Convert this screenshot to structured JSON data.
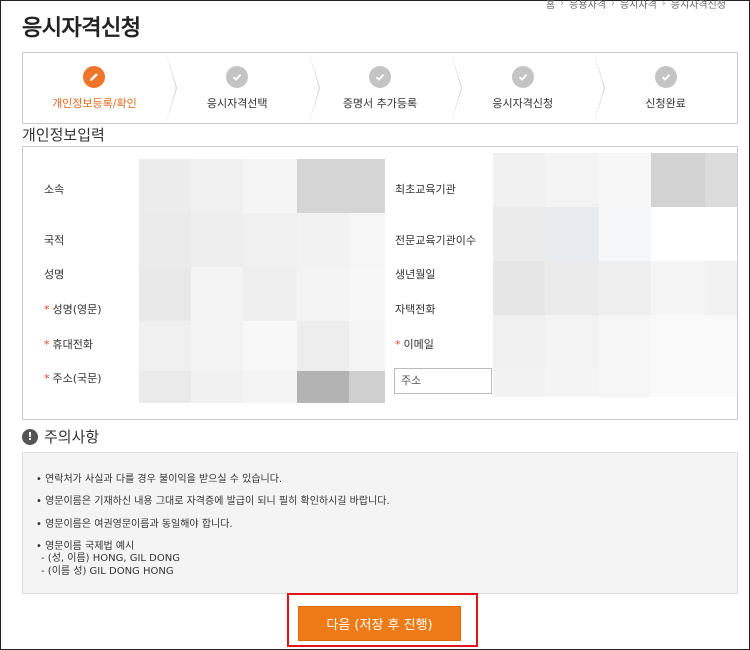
{
  "breadcrumb": [
    "홈",
    "응용자격",
    "응시자격",
    "응시자격신청"
  ],
  "page_title": "응시자격신청",
  "steps": [
    {
      "label": "개인정보등록/확인",
      "active": true,
      "icon": "pencil-icon"
    },
    {
      "label": "응시자격선택",
      "active": false,
      "icon": "check-icon"
    },
    {
      "label": "증명서 추가등록",
      "active": false,
      "icon": "check-icon"
    },
    {
      "label": "응시자격신청",
      "active": false,
      "icon": "check-icon"
    },
    {
      "label": "신청완료",
      "active": false,
      "icon": "check-icon"
    }
  ],
  "section_title": "개인정보입력",
  "fields_left": [
    {
      "label": "소속",
      "required": false
    },
    {
      "label": "국적",
      "required": false
    },
    {
      "label": "성명",
      "required": false
    },
    {
      "label": "성명(영문)",
      "required": true
    },
    {
      "label": "휴대전화",
      "required": true
    },
    {
      "label": "주소(국문)",
      "required": true
    }
  ],
  "fields_right": [
    {
      "label": "최초교육기관",
      "required": false
    },
    {
      "label": "전문교육기관이수",
      "required": false
    },
    {
      "label": "생년월일",
      "required": false
    },
    {
      "label": "자택전화",
      "required": false
    },
    {
      "label": "이메일",
      "required": true
    }
  ],
  "address_placeholder": "주소",
  "required_mark": "*",
  "notice": {
    "title": "주의사항",
    "items": [
      "• 연락처가 사실과 다를 경우 불이익을 받으실 수 있습니다.",
      "• 영문이름은 기재하신 내용 그대로 자격증에 발급이 되니 필히 확인하시길 바랍니다.",
      "• 영문이름은 여권영문이름과 동일해야 합니다.",
      "• 영문이름 국제법 예시"
    ],
    "examples": [
      "- (성, 이름) HONG, GIL DONG",
      "- (이름 성) GIL DONG HONG"
    ]
  },
  "next_button": "다음 (저장 후 진행)",
  "colors": {
    "accent": "#ef7a18",
    "active_step_text": "#e86a1d",
    "highlight_border": "#e0141a",
    "required": "#e8452c"
  }
}
